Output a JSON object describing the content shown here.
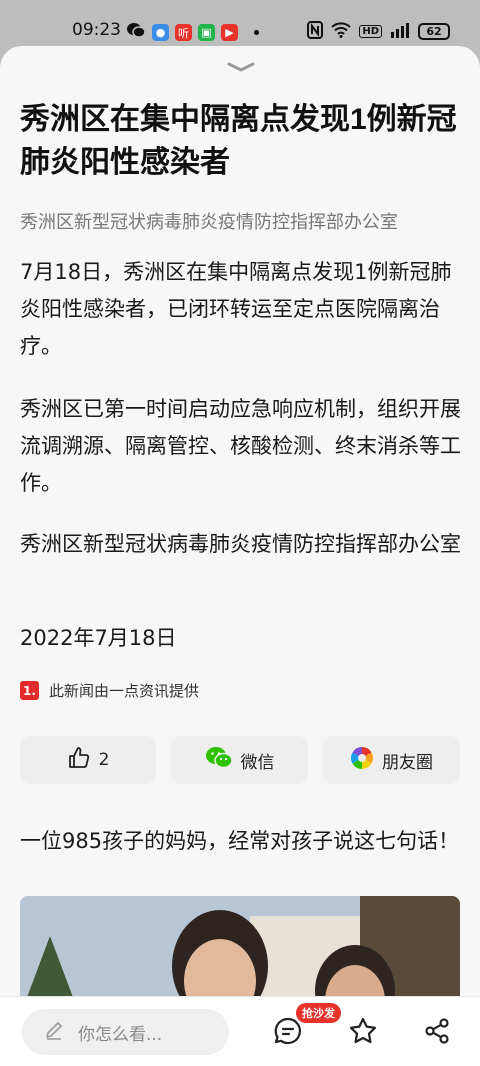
{
  "status_bar": {
    "time": "09:23",
    "app_icons": [
      {
        "name": "wechat-icon",
        "color": "#bdbdbd"
      },
      {
        "name": "browser-icon",
        "color": "#3b8ee6"
      },
      {
        "name": "listen-icon",
        "color": "#e8322c",
        "glyph": "听"
      },
      {
        "name": "iqiyi-icon",
        "color": "#22b34a"
      },
      {
        "name": "video-icon",
        "color": "#e8322c"
      }
    ],
    "battery": "62"
  },
  "article": {
    "title": "秀洲区在集中隔离点发现1例新冠肺炎阳性感染者",
    "source": "秀洲区新型冠状病毒肺炎疫情防控指挥部办公室",
    "paragraphs": [
      "7月18日，秀洲区在集中隔离点发现1例新冠肺炎阳性感染者，已闭环转运至定点医院隔离治疗。",
      "秀洲区已第一时间启动应急响应机制，组织开展流调溯源、隔离管控、核酸检测、终末消杀等工作。",
      "秀洲区新型冠状病毒肺炎疫情防控指挥部办公室"
    ],
    "date": "2022年7月18日",
    "provider_logo": "1.",
    "provider": "此新闻由一点资讯提供"
  },
  "actions": {
    "like_count": "2",
    "wechat_label": "微信",
    "moments_label": "朋友圈"
  },
  "recommendation": {
    "title": "一位985孩子的妈妈，经常对孩子说这七句话！"
  },
  "bottom_bar": {
    "comment_placeholder": "你怎么看...",
    "badge": "抢沙发"
  },
  "colors": {
    "accent_red": "#e8322c",
    "wechat_green": "#2dc100"
  }
}
